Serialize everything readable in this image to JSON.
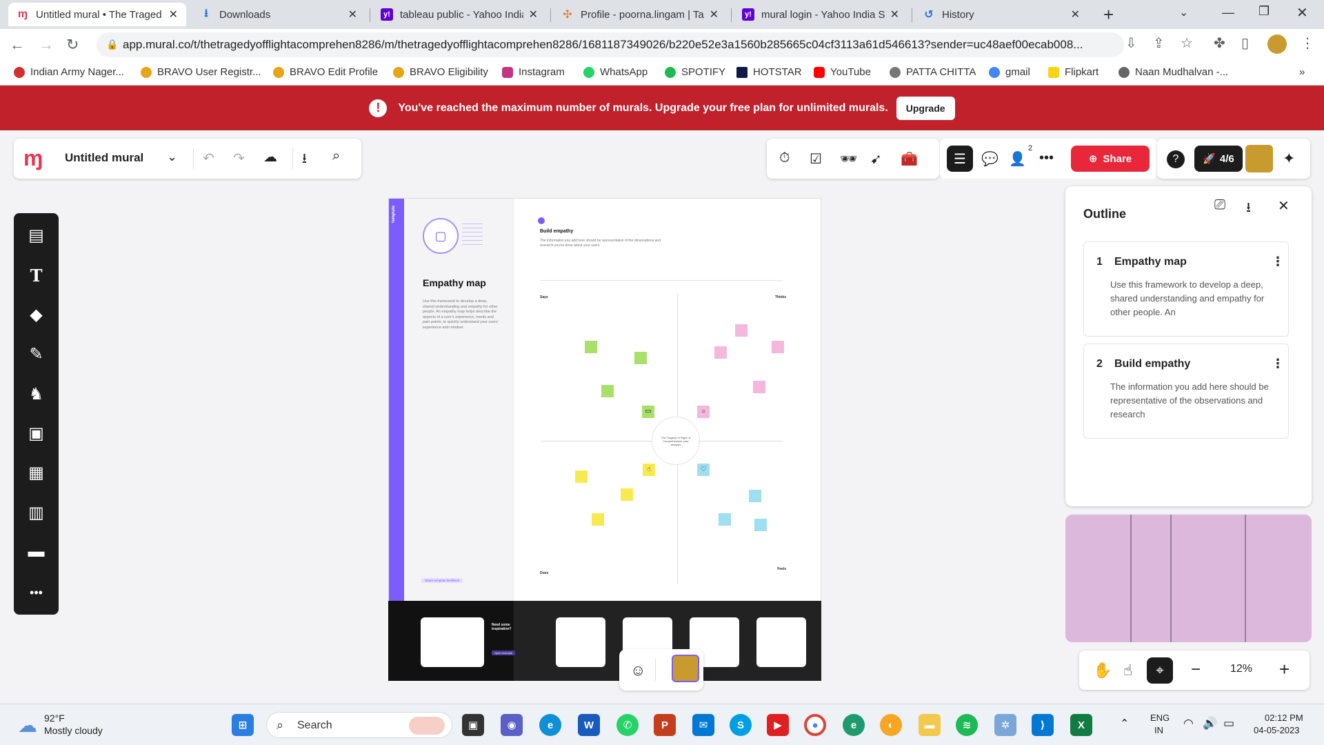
{
  "browser": {
    "tabs": [
      {
        "title": "Untitled mural • The Traged",
        "active": true,
        "icon_color": "#e8384f"
      },
      {
        "title": "Downloads",
        "active": false,
        "icon_color": "#1a73e8"
      },
      {
        "title": "tableau public - Yahoo India",
        "active": false,
        "icon_color": "#6001d2"
      },
      {
        "title": "Profile - poorna.lingam | Tal",
        "active": false,
        "icon_color": "#e97627"
      },
      {
        "title": "mural login - Yahoo India S",
        "active": false,
        "icon_color": "#6001d2"
      },
      {
        "title": "History",
        "active": false,
        "icon_color": "#1a73e8"
      }
    ],
    "url": "app.mural.co/t/thetragedyofflightacomprehen8286/m/thetragedyofflightacomprehen8286/1681187349026/b220e52e3a1560b285665c04cf3113a61d546613?sender=uc48aef00ecab008...",
    "bookmarks": [
      "Indian Army Nager...",
      "BRAVO User Registr...",
      "BRAVO Edit Profile",
      "BRAVO Eligibility",
      "Instagram",
      "WhatsApp",
      "SPOTIFY",
      "HOTSTAR",
      "YouTube",
      "PATTA CHITTA",
      "gmail",
      "Flipkart",
      "Naan Mudhalvan -..."
    ]
  },
  "banner": {
    "message": "You've reached the maximum number of murals. Upgrade your free plan for unlimited murals.",
    "upgrade_label": "Upgrade"
  },
  "toolbar": {
    "mural_title": "Untitled mural",
    "share_label": "Share",
    "collab_count": "4/6",
    "members_badge": "2"
  },
  "board": {
    "template_tag": "Template",
    "title": "Empathy map",
    "description": "Use this framework to develop a deep, shared understanding and empathy for other people. An empathy map helps describe the aspects of a user's experience, needs and pain points, to quickly understand your users' experience and mindset.",
    "feedback": "Share template feedback",
    "section_title": "Build empathy",
    "section_desc": "The information you add here should be representative of the observations and research you've done about your users.",
    "quadrants": {
      "says": "Says",
      "thinks": "Thinks",
      "does": "Does",
      "feels": "Feels"
    },
    "center_label": "The Tragedy of Flight: A Comprehensive case analysis",
    "inspiration_title": "Need some inspiration?",
    "inspiration_link": "Open example"
  },
  "outline": {
    "title": "Outline",
    "items": [
      {
        "num": "1",
        "title": "Empathy map",
        "desc": "Use this framework to develop a deep, shared understanding and empathy for other people. An"
      },
      {
        "num": "2",
        "title": "Build empathy",
        "desc": "The information you add here should be representative of the observations and research"
      }
    ]
  },
  "zoom": {
    "level": "12%"
  },
  "taskbar": {
    "weather_temp": "92°F",
    "weather_desc": "Mostly cloudy",
    "search_label": "Search",
    "lang_top": "ENG",
    "lang_bottom": "IN",
    "time": "02:12 PM",
    "date": "04-05-2023"
  },
  "colors": {
    "mural_purple": "#7b5cff",
    "banner_red": "#c0212b",
    "share_red": "#e8273b",
    "minimap": "#dcb8dc"
  }
}
